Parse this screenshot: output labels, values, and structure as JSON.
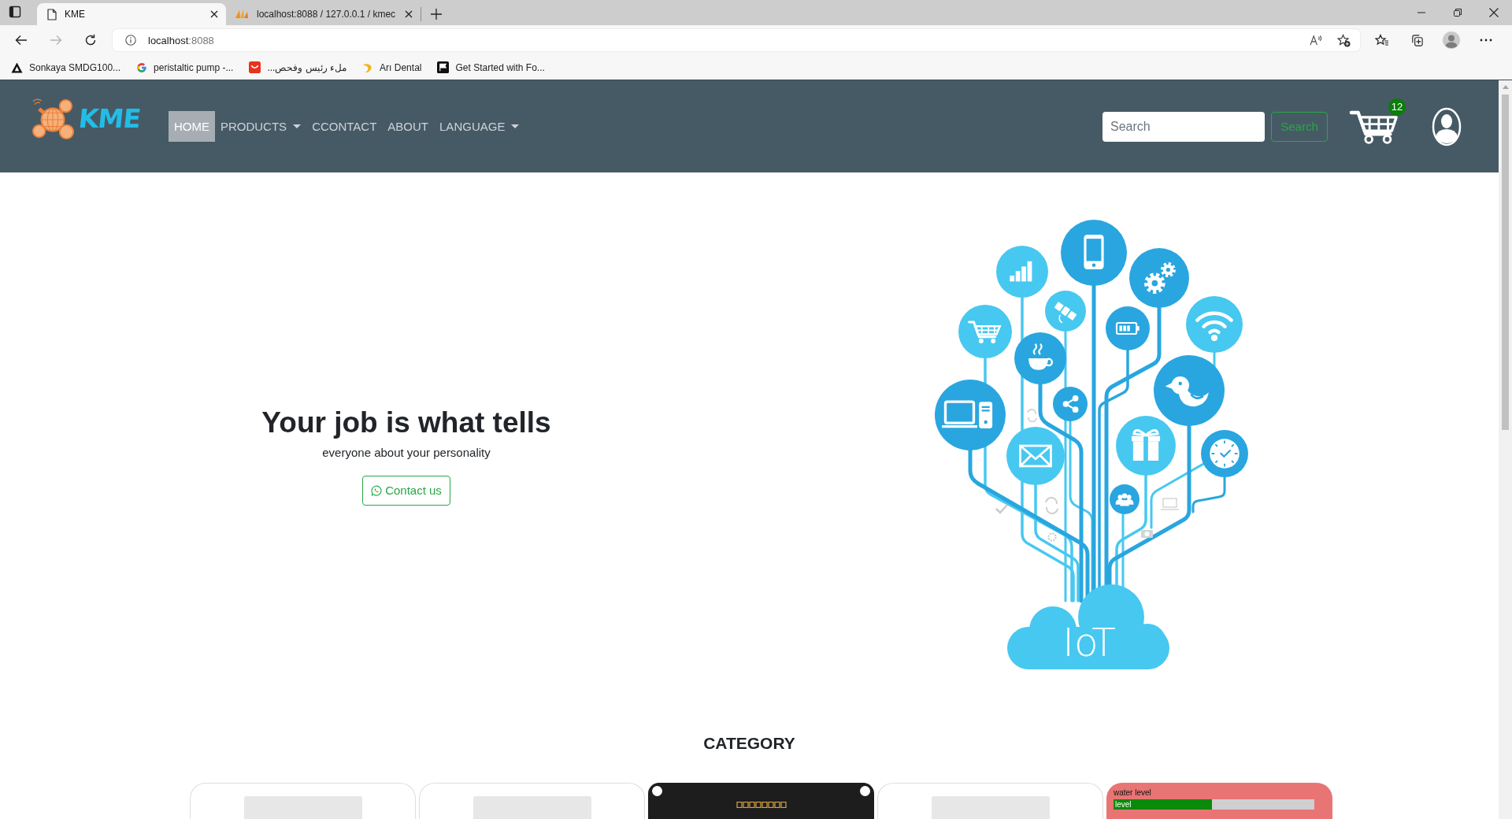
{
  "browser": {
    "tabs": [
      {
        "title": "KME",
        "kind": "page",
        "selected": true
      },
      {
        "title": "localhost:8088 / 127.0.0.1 / kmec",
        "kind": "pma",
        "selected": false
      }
    ],
    "toolbar": {
      "back": {
        "disabled": false
      },
      "forward": {
        "disabled": true
      }
    },
    "address": {
      "host": "localhost",
      "port": ":8088"
    },
    "bookmarks": [
      {
        "label": "Sonkaya SMDG100...",
        "kind": "triangle"
      },
      {
        "label": "peristaltic pump -...",
        "kind": "ring"
      },
      {
        "label": "ملء رئيس وفحص...",
        "kind": "bag"
      },
      {
        "label": "Arı Dental",
        "kind": "swoosh"
      },
      {
        "label": "Get Started with Fo...",
        "kind": "flag"
      }
    ]
  },
  "navbar": {
    "logo_text": "KME",
    "items": [
      {
        "label": "HOME",
        "selected": true,
        "dropdown": false
      },
      {
        "label": "PRODUCTS",
        "selected": false,
        "dropdown": true
      },
      {
        "label": "CCONTACT",
        "selected": false,
        "dropdown": false
      },
      {
        "label": "ABOUT",
        "selected": false,
        "dropdown": false
      },
      {
        "label": "LANGUAGE",
        "selected": false,
        "dropdown": true
      }
    ],
    "search": {
      "placeholder": "Search",
      "button": "Search"
    },
    "cart_count": "12"
  },
  "hero": {
    "title": "Your job is what tells",
    "subtitle": "everyone about your personality",
    "button": "Contact us",
    "illustration_label": "IoT"
  },
  "category": {
    "title": "CATEGORY",
    "cards": [
      {
        "kind": "photo"
      },
      {
        "kind": "photo"
      },
      {
        "kind": "board"
      },
      {
        "kind": "photo"
      },
      {
        "kind": "screenshot",
        "title": "water level",
        "label": "level",
        "level": 0.49
      }
    ]
  }
}
